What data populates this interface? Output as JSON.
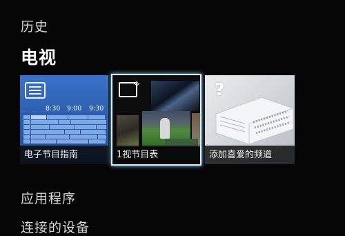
{
  "menu": {
    "history": "历史",
    "tv": "电视",
    "apps": "应用程序",
    "devices": "连接的设备"
  },
  "tiles": {
    "epg": {
      "label": "电子节目指南",
      "times": [
        "8:30",
        "9:00",
        "9:30"
      ],
      "icon": "tv-guide-icon"
    },
    "schedule": {
      "label": "1视节目表",
      "icon": "tv-schedule-icon",
      "selected": true
    },
    "favorites": {
      "label": "添加喜爱的频道",
      "icon": "question-mark-icon"
    }
  },
  "colors": {
    "background": "#060606",
    "epg_blue": "#285aa9",
    "focus_border": "#d6f0ff"
  }
}
